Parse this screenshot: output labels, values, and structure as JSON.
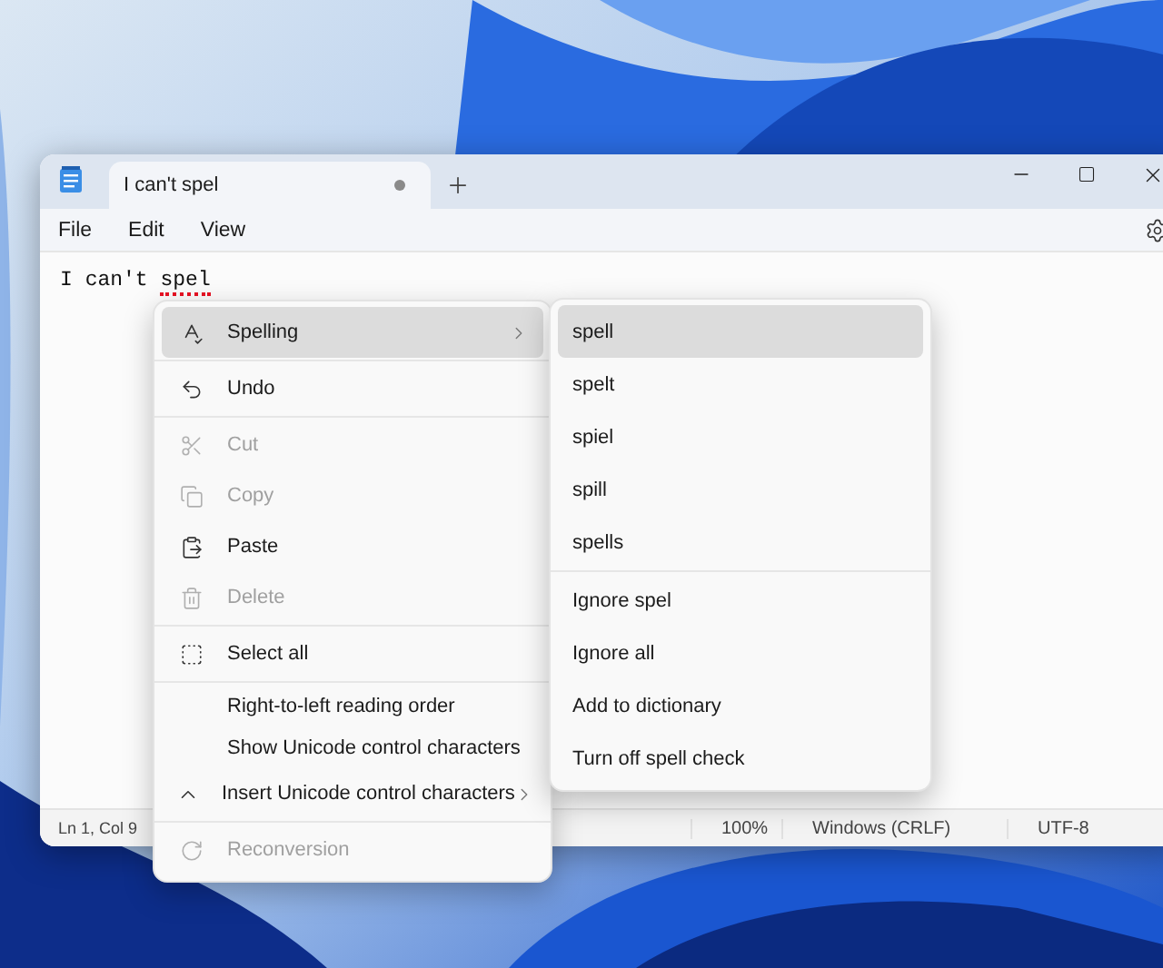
{
  "window": {
    "tab": {
      "title": "I can't spel",
      "modified": true,
      "selected": true
    },
    "menus": [
      {
        "label": "File"
      },
      {
        "label": "Edit"
      },
      {
        "label": "View"
      }
    ],
    "editor": {
      "words": [
        {
          "text": "I",
          "misspelled": false
        },
        {
          "text": "can't",
          "misspelled": false
        },
        {
          "text": "spel",
          "misspelled": true
        }
      ]
    },
    "status_bar": [
      "Ln 1, Col 9",
      "100%",
      "Windows (CRLF)",
      "UTF-8"
    ]
  },
  "context_menu": {
    "groups": [
      [
        {
          "kind": "spelling",
          "label": "Spelling",
          "disabled": false,
          "submenu": true,
          "selected": true
        }
      ],
      [
        {
          "kind": "undo",
          "label": "Undo",
          "disabled": false,
          "submenu": false,
          "selected": false
        }
      ],
      [
        {
          "kind": "cut",
          "label": "Cut",
          "disabled": true,
          "submenu": false,
          "selected": false
        },
        {
          "kind": "copy",
          "label": "Copy",
          "disabled": true,
          "submenu": false,
          "selected": false
        },
        {
          "kind": "paste",
          "label": "Paste",
          "disabled": false,
          "submenu": false,
          "selected": false
        },
        {
          "kind": "delete",
          "label": "Delete",
          "disabled": true,
          "submenu": false,
          "selected": false
        }
      ],
      [
        {
          "kind": "select-all",
          "label": "Select all",
          "disabled": false,
          "submenu": false,
          "selected": false
        }
      ],
      [
        {
          "kind": "plain",
          "label": "Right-to-left reading order",
          "disabled": false,
          "submenu": false,
          "selected": false
        },
        {
          "kind": "plain",
          "label": "Show Unicode control characters",
          "disabled": false,
          "submenu": false,
          "selected": false
        },
        {
          "kind": "insert",
          "label": "Insert Unicode control characters",
          "disabled": false,
          "submenu": true,
          "selected": false
        }
      ],
      [
        {
          "kind": "reconversion",
          "label": "Reconversion",
          "disabled": true,
          "submenu": false,
          "selected": false
        }
      ]
    ]
  },
  "spelling_submenu": {
    "groups": [
      [
        {
          "label": "spell",
          "selected": true
        },
        {
          "label": "spelt",
          "selected": false
        },
        {
          "label": "spiel",
          "selected": false
        },
        {
          "label": "spill",
          "selected": false
        },
        {
          "label": "spells",
          "selected": false
        }
      ],
      [
        {
          "label": "Ignore spel",
          "selected": false
        },
        {
          "label": "Ignore all",
          "selected": false
        },
        {
          "label": "Add to dictionary",
          "selected": false
        },
        {
          "label": "Turn off spell check",
          "selected": false
        }
      ]
    ]
  }
}
